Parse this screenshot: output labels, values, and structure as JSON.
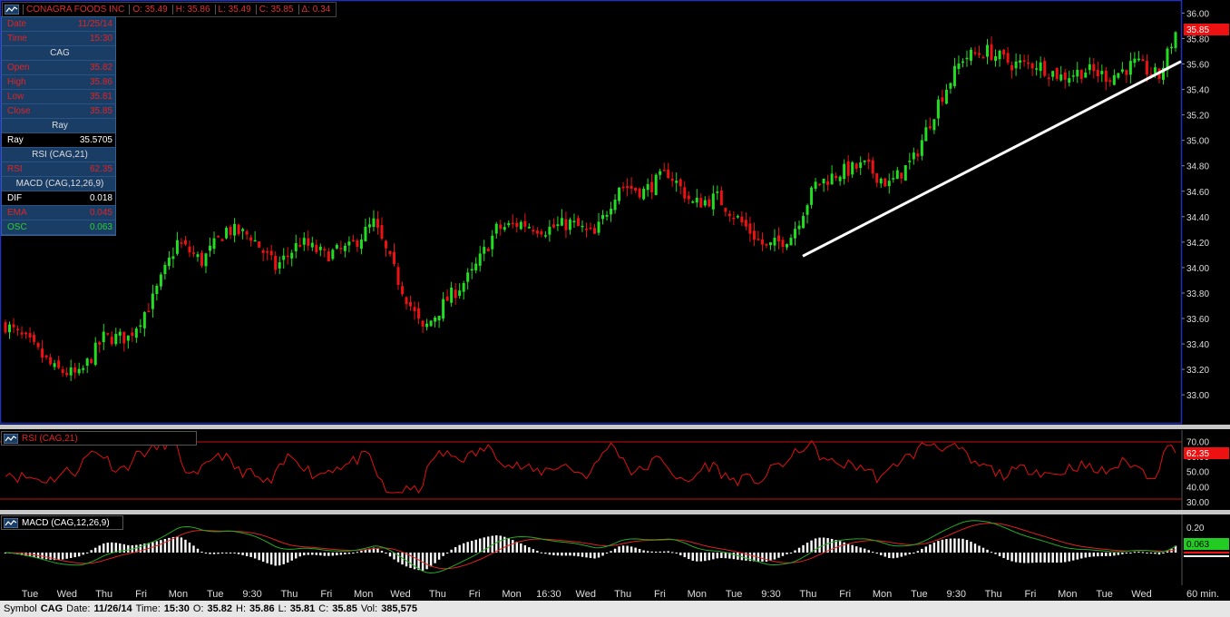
{
  "header": {
    "symbol_name": "CONAGRA FOODS INC",
    "open": "O: 35.49",
    "high": "H: 35.86",
    "low": "L: 35.49",
    "close": "C: 35.85",
    "change": "Δ: 0.34"
  },
  "info_box": {
    "date_label": "Date",
    "date_value": "11/25/14",
    "time_label": "Time",
    "time_value": "15:30",
    "symbol": "CAG",
    "open_label": "Open",
    "open_value": "35.82",
    "high_label": "High",
    "high_value": "35.86",
    "low_label": "Low",
    "low_value": "35.81",
    "close_label": "Close",
    "close_value": "35.85",
    "ray_header": "Ray",
    "ray_label": "Ray",
    "ray_value": "35.5705",
    "rsi_header": "RSI (CAG,21)",
    "rsi_label": "RSI",
    "rsi_value": "62.35",
    "macd_header": "MACD (CAG,12,26,9)",
    "dif_label": "DIF",
    "dif_value": "0.018",
    "ema_label": "EMA",
    "ema_value": "0.045",
    "osc_label": "OSC",
    "osc_value": "0.063"
  },
  "rsi_panel": {
    "label": "RSI (CAG,21)",
    "current_value": "62.35"
  },
  "macd_panel": {
    "label": "MACD (CAG,12,26,9)",
    "current_value": "0.063"
  },
  "price_tag": "35.85",
  "status_bar": {
    "symbol_label": "Symbol",
    "symbol_value": "CAG",
    "date_label": "Date:",
    "date_value": "11/26/14",
    "time_label": "Time:",
    "time_value": "15:30",
    "open_label": "O:",
    "open_value": "35.82",
    "high_label": "H:",
    "high_value": "35.86",
    "low_label": "L:",
    "low_value": "35.81",
    "close_label": "C:",
    "close_value": "35.85",
    "vol_label": "Vol:",
    "vol_value": "385,575"
  },
  "interval": "60 min.",
  "colors": {
    "up": "#22dd22",
    "down": "#ee1111",
    "rsi_line": "#dd1111",
    "macd_dif": "#22aa22",
    "macd_ema": "#dd2222",
    "trend": "#ffffff",
    "frame": "#2030c0"
  },
  "chart_data": [
    {
      "type": "candlestick",
      "title": "CONAGRA FOODS INC",
      "y_ticks": [
        33.0,
        33.2,
        33.4,
        33.6,
        33.8,
        34.0,
        34.2,
        34.4,
        34.6,
        34.8,
        35.0,
        35.2,
        35.4,
        35.6,
        35.8,
        36.0
      ],
      "ylim": [
        32.78,
        36.06
      ],
      "x_tick_labels": [
        "Tue",
        "Wed",
        "Thu",
        "Fri",
        "Mon",
        "Tue",
        "9:30",
        "Thu",
        "Fri",
        "Mon",
        "Wed",
        "Thu",
        "Fri",
        "Mon",
        "16:30",
        "Wed",
        "Thu",
        "Fri",
        "Mon",
        "Tue",
        "9:30",
        "Thu",
        "Fri",
        "Mon",
        "Tue",
        "9:30",
        "Thu",
        "Fri",
        "Mon",
        "Tue",
        "Wed"
      ],
      "close_path": [
        [
          0,
          33.55
        ],
        [
          6,
          33.4
        ],
        [
          12,
          33.2
        ],
        [
          18,
          33.15
        ],
        [
          24,
          33.45
        ],
        [
          30,
          33.45
        ],
        [
          36,
          33.75
        ],
        [
          42,
          34.2
        ],
        [
          48,
          34.05
        ],
        [
          54,
          34.3
        ],
        [
          60,
          34.25
        ],
        [
          66,
          34.0
        ],
        [
          72,
          34.2
        ],
        [
          78,
          34.1
        ],
        [
          84,
          34.15
        ],
        [
          90,
          34.35
        ],
        [
          96,
          33.9
        ],
        [
          102,
          33.5
        ],
        [
          108,
          33.75
        ],
        [
          114,
          33.95
        ],
        [
          120,
          34.3
        ],
        [
          126,
          34.35
        ],
        [
          132,
          34.3
        ],
        [
          138,
          34.35
        ],
        [
          144,
          34.25
        ],
        [
          150,
          34.65
        ],
        [
          156,
          34.6
        ],
        [
          162,
          34.75
        ],
        [
          168,
          34.5
        ],
        [
          174,
          34.55
        ],
        [
          180,
          34.35
        ],
        [
          186,
          34.15
        ],
        [
          192,
          34.25
        ],
        [
          198,
          34.65
        ],
        [
          204,
          34.75
        ],
        [
          210,
          34.8
        ],
        [
          216,
          34.65
        ],
        [
          222,
          34.85
        ],
        [
          228,
          35.3
        ],
        [
          234,
          35.65
        ],
        [
          240,
          35.7
        ],
        [
          246,
          35.6
        ],
        [
          252,
          35.6
        ],
        [
          258,
          35.5
        ],
        [
          264,
          35.55
        ],
        [
          270,
          35.5
        ],
        [
          276,
          35.6
        ],
        [
          282,
          35.5
        ],
        [
          286,
          35.85
        ]
      ],
      "ray_trendline": {
        "from": [
          34.09
        ],
        "to": [
          35.62
        ]
      },
      "ray_value": 35.5705
    },
    {
      "type": "line",
      "title": "RSI (CAG,21)",
      "y_ticks": [
        30.0,
        40.0,
        50.0,
        60.0,
        70.0
      ],
      "ylim": [
        27,
        75
      ],
      "reference_lines": [
        70,
        30
      ],
      "current": 62.35
    },
    {
      "type": "bar",
      "title": "MACD (CAG,12,26,9)",
      "y_ticks": [
        0.2
      ],
      "dif": 0.018,
      "ema": 0.045,
      "osc": 0.063
    }
  ]
}
